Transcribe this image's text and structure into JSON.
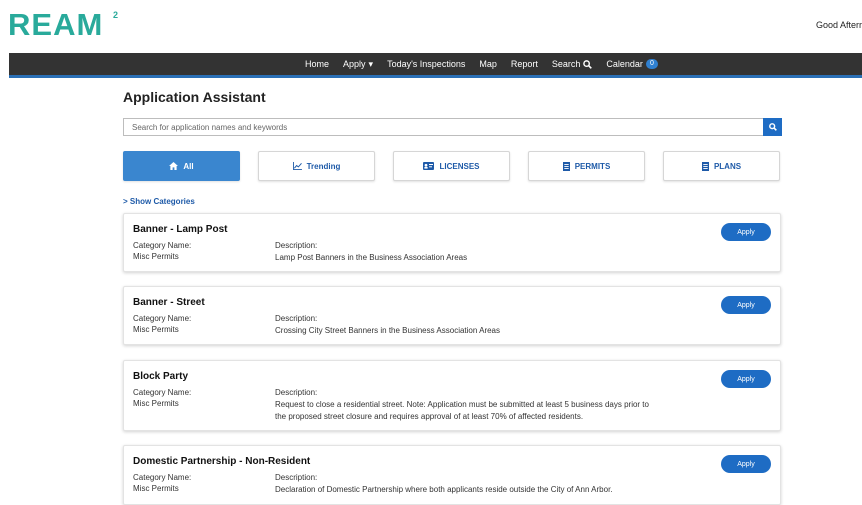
{
  "brand": {
    "logo_text": "REAM",
    "logo_superscript": "2"
  },
  "header": {
    "greeting": "Good Afterr"
  },
  "nav": {
    "items": [
      "Home",
      "Apply",
      "Today's Inspections",
      "Map",
      "Report",
      "Search",
      "Calendar"
    ],
    "calendar_count": "0"
  },
  "page": {
    "title": "Application Assistant"
  },
  "search": {
    "placeholder": "Search for application names and keywords"
  },
  "filters": [
    "All",
    "Trending",
    "LICENSES",
    "PERMITS",
    "PLANS"
  ],
  "show_categories": "> Show Categories",
  "labels": {
    "category": "Category Name:",
    "description": "Description:",
    "apply": "Apply"
  },
  "applications": [
    {
      "title": "Banner - Lamp Post",
      "category": "Misc Permits",
      "description": "Lamp Post Banners in the Business Association Areas"
    },
    {
      "title": "Banner - Street",
      "category": "Misc Permits",
      "description": "Crossing City Street Banners in the Business Association Areas"
    },
    {
      "title": "Block Party",
      "category": "Misc Permits",
      "description": "Request to close a residential street. Note: Application must be submitted at least 5 business days prior to the proposed street closure and requires approval of at least 70% of affected residents."
    },
    {
      "title": "Domestic Partnership - Non-Resident",
      "category": "Misc Permits",
      "description": "Declaration of Domestic Partnership where both applicants reside outside the City of Ann Arbor."
    }
  ],
  "colors": {
    "brand": "#29aa9b",
    "accent": "#1e6cc4",
    "navbar": "#333333"
  }
}
